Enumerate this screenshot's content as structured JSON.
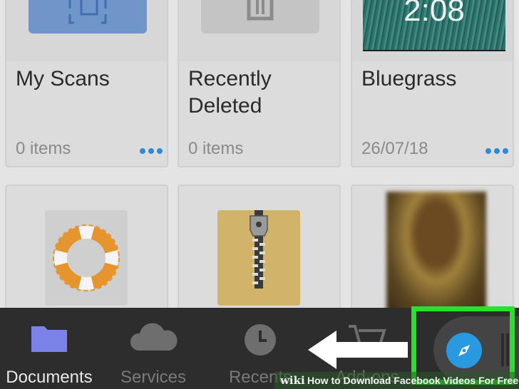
{
  "colors": {
    "accent_blue": "#2e8ad6",
    "highlight_green": "#2ae02a",
    "tabbar_bg": "#2d2d2d",
    "documents_folder": "#7b83e8",
    "lifebuoy_orange": "#e6952e"
  },
  "cards": [
    {
      "title": "My Scans",
      "sub": "0 items",
      "icon": "scan-document-icon"
    },
    {
      "title": "Recently Deleted",
      "sub": "0 items",
      "icon": "trash-icon"
    },
    {
      "title": "Bluegrass",
      "sub": "26/07/18",
      "thumb_time": "2:08",
      "icon": "video-thumbnail"
    },
    {
      "icon": "lifebuoy-icon"
    },
    {
      "icon": "zip-archive-icon"
    },
    {
      "icon": "mona-lisa-thumbnail"
    }
  ],
  "tabbar": {
    "tabs": [
      {
        "label": "Documents",
        "icon": "folder-icon",
        "active": true
      },
      {
        "label": "Services",
        "icon": "cloud-icon",
        "active": false
      },
      {
        "label": "Recents",
        "icon": "clock-icon",
        "active": false
      },
      {
        "label": "Add-ons",
        "icon": "cart-icon",
        "active": false
      }
    ],
    "browser_icon": "compass-icon"
  },
  "watermark": {
    "wiki": "wiki",
    "text": "How to Download Facebook Videos For Free"
  }
}
